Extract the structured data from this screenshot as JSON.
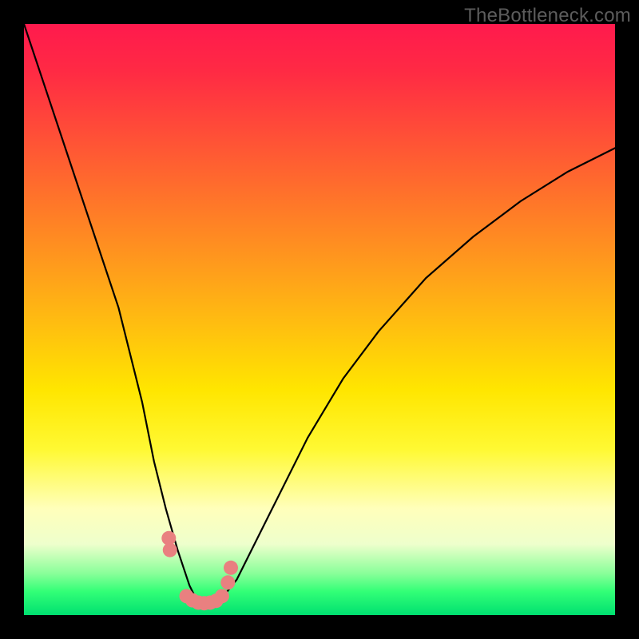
{
  "watermark": "TheBottleneck.com",
  "chart_data": {
    "type": "line",
    "title": "",
    "xlabel": "",
    "ylabel": "",
    "xlim": [
      0,
      100
    ],
    "ylim": [
      0,
      100
    ],
    "series": [
      {
        "name": "curve",
        "x": [
          0,
          4,
          8,
          12,
          16,
          20,
          22,
          24,
          26,
          27,
          28,
          29,
          30,
          31,
          32,
          33,
          34,
          36,
          38,
          42,
          48,
          54,
          60,
          68,
          76,
          84,
          92,
          100
        ],
        "values": [
          100,
          88,
          76,
          64,
          52,
          36,
          26,
          18,
          11,
          8,
          5,
          3,
          2,
          2,
          2,
          2.5,
          3.5,
          6,
          10,
          18,
          30,
          40,
          48,
          57,
          64,
          70,
          75,
          79
        ]
      },
      {
        "name": "markers",
        "x": [
          24.5,
          24.7,
          27.5,
          28.5,
          29.5,
          30.5,
          31.5,
          32.5,
          33.5,
          34.5,
          35.0
        ],
        "values": [
          13,
          11,
          3.2,
          2.5,
          2.1,
          2.0,
          2.1,
          2.4,
          3.2,
          5.5,
          8
        ]
      }
    ],
    "colors": {
      "curve_stroke": "#000000",
      "marker_fill": "#e98080",
      "gradient_top": "#ff1a4d",
      "gradient_bottom": "#00e070"
    }
  }
}
